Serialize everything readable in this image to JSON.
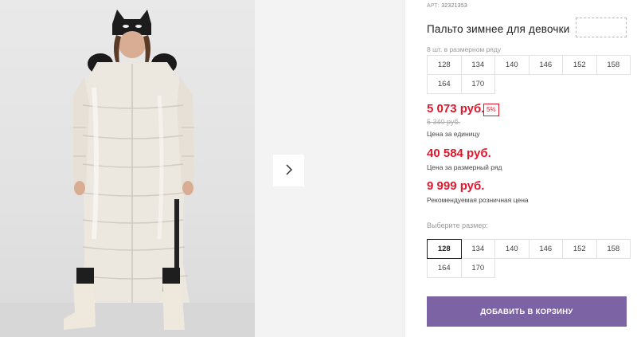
{
  "gallery": {
    "next_icon": "chevron-right-icon"
  },
  "product": {
    "art_label": "АРТ:",
    "art_code": "32321353",
    "title": "Пальто зимнее для девочки",
    "row_info": "8 шт. в размерном ряду",
    "row_sizes": [
      "128",
      "134",
      "140",
      "146",
      "152",
      "158",
      "164",
      "170"
    ],
    "price_unit": "5 073 руб.",
    "discount": "5%",
    "price_old": "5 340 руб.",
    "price_unit_label": "Цена за единицу",
    "price_row": "40 584 руб.",
    "price_row_label": "Цена за размерный ряд",
    "price_rrp": "9 999 руб.",
    "price_rrp_label": "Рекомендуемая розничная цена",
    "choose_size_label": "Выберите размер:",
    "choose_sizes": [
      "128",
      "134",
      "140",
      "146",
      "152",
      "158",
      "164",
      "170"
    ],
    "selected_size": "128",
    "add_to_cart": "ДОБАВИТЬ В КОРЗИНУ"
  },
  "colors": {
    "price_red": "#e0162b",
    "button_purple": "#7c63a4"
  }
}
